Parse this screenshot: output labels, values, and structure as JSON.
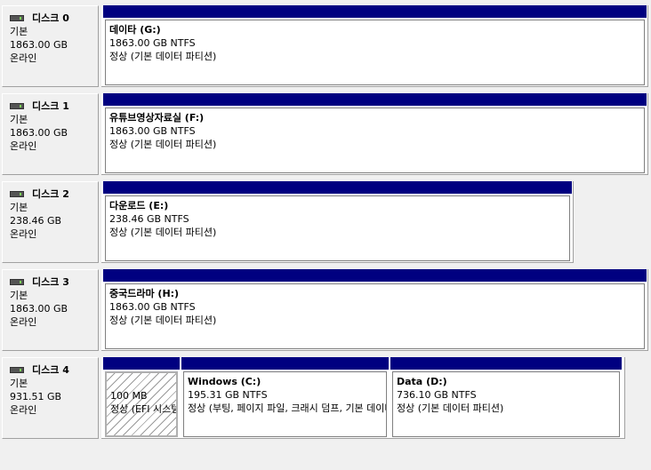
{
  "disks": [
    {
      "name": "디스크 0",
      "type": "기본",
      "size": "1863.00 GB",
      "status": "온라인",
      "partitions": [
        {
          "label": "데이타  (G:)",
          "size_fs": "1863.00 GB NTFS",
          "state": "정상 (기본 데이터 파티션)",
          "hatched": false
        }
      ]
    },
    {
      "name": "디스크 1",
      "type": "기본",
      "size": "1863.00 GB",
      "status": "온라인",
      "partitions": [
        {
          "label": "유튜브영상자료실  (F:)",
          "size_fs": "1863.00 GB NTFS",
          "state": "정상 (기본 데이터 파티션)",
          "hatched": false
        }
      ]
    },
    {
      "name": "디스크 2",
      "type": "기본",
      "size": "238.46 GB",
      "status": "온라인",
      "partitions": [
        {
          "label": "다운로드  (E:)",
          "size_fs": "238.46 GB NTFS",
          "state": "정상 (기본 데이터 파티션)",
          "hatched": false
        }
      ]
    },
    {
      "name": "디스크 3",
      "type": "기본",
      "size": "1863.00 GB",
      "status": "온라인",
      "partitions": [
        {
          "label": "중국드라마  (H:)",
          "size_fs": "1863.00 GB NTFS",
          "state": "정상 (기본 데이터 파티션)",
          "hatched": false
        }
      ]
    },
    {
      "name": "디스크 4",
      "type": "기본",
      "size": "931.51 GB",
      "status": "온라인",
      "partitions": [
        {
          "label": "",
          "size_fs": "100 MB",
          "state": "정상 (EFI 시스템 파티션)",
          "hatched": true
        },
        {
          "label": "Windows  (C:)",
          "size_fs": "195.31 GB NTFS",
          "state": "정상 (부팅, 페이지 파일, 크래시 덤프, 기본 데이터 파티션)",
          "hatched": false
        },
        {
          "label": "Data  (D:)",
          "size_fs": "736.10 GB NTFS",
          "state": "정상 (기본 데이터 파티션)",
          "hatched": false
        }
      ]
    }
  ],
  "colors": {
    "partition_header": "#000080",
    "background": "#f0f0f0"
  },
  "icons": {
    "disk": "disk-drive-icon"
  }
}
